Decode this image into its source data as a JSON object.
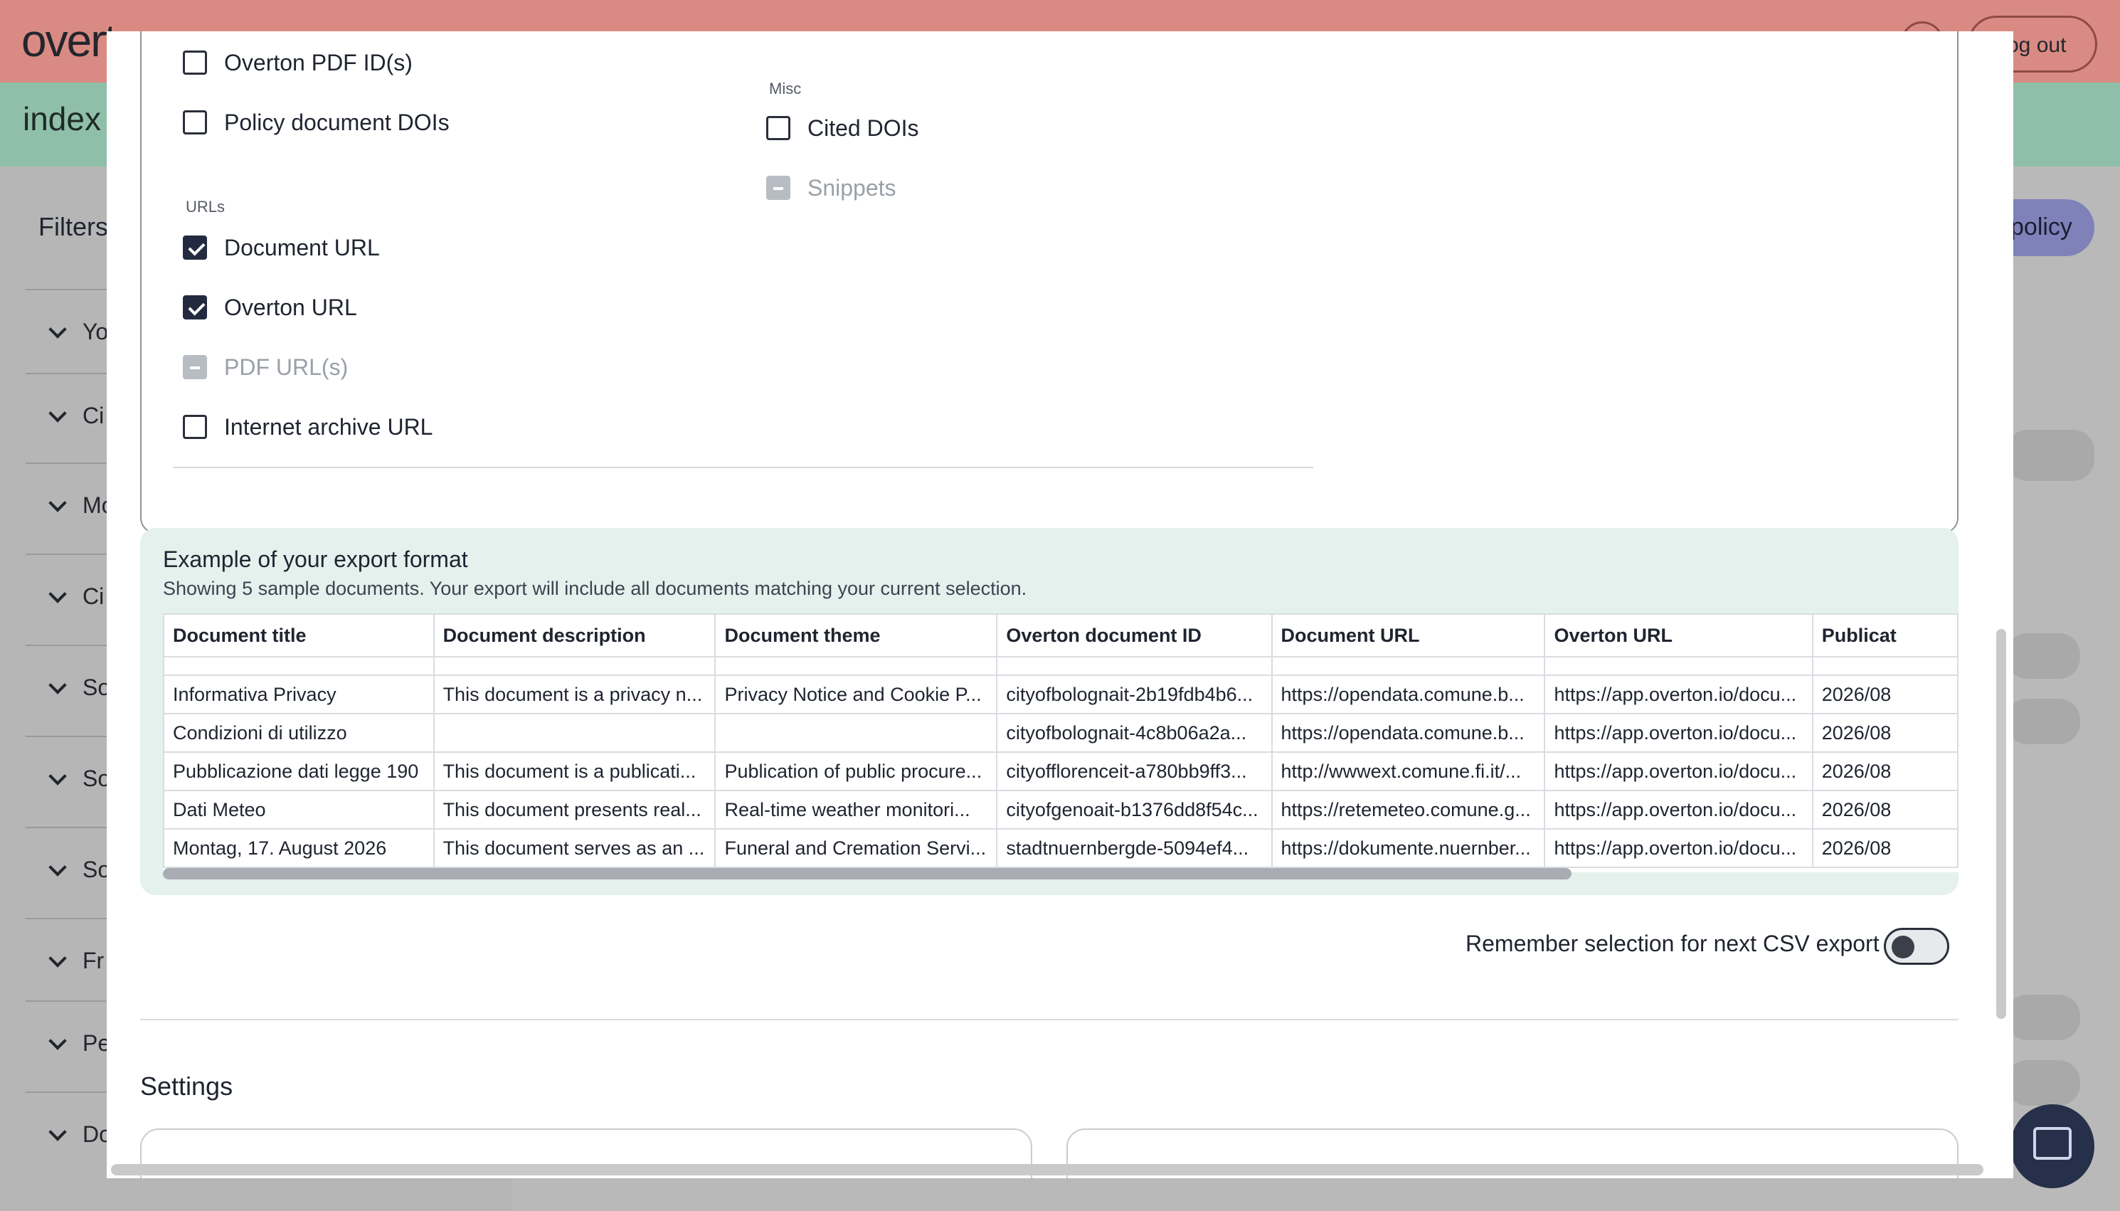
{
  "background": {
    "logo": "overt",
    "logout": "og out",
    "index": "index",
    "filters": "Filters",
    "policy_button": "policy",
    "filter_rows": [
      "Yo",
      "Ci",
      "Mo",
      "Ci",
      "So",
      "So",
      "So",
      "Fr",
      "Pe",
      "Do"
    ]
  },
  "modal": {
    "groups": [
      {
        "label": "",
        "items": [
          {
            "label": "Overton PDF ID(s)",
            "state": "unchecked"
          },
          {
            "label": "Policy document DOIs",
            "state": "unchecked"
          }
        ]
      },
      {
        "label": "URLs",
        "items": [
          {
            "label": "Document URL",
            "state": "checked"
          },
          {
            "label": "Overton URL",
            "state": "checked"
          },
          {
            "label": "PDF URL(s)",
            "state": "indeterminate"
          },
          {
            "label": "Internet archive URL",
            "state": "unchecked"
          }
        ]
      },
      {
        "label": "Misc",
        "items": [
          {
            "label": "Cited DOIs",
            "state": "unchecked"
          },
          {
            "label": "Snippets",
            "state": "indeterminate"
          }
        ]
      }
    ],
    "example": {
      "title": "Example of your export format",
      "subtitle": "Showing 5 sample documents. Your export will include all documents matching your current selection.",
      "columns": [
        "Document title",
        "Document description",
        "Document theme",
        "Overton document ID",
        "Document URL",
        "Overton URL",
        "Publicat"
      ],
      "rows": [
        [
          "Informativa Privacy",
          "This document is a privacy n...",
          "Privacy Notice and Cookie P...",
          "cityofbolognait-2b19fdb4b6...",
          "https://opendata.comune.b...",
          "https://app.overton.io/docu...",
          "2026/08"
        ],
        [
          "Condizioni di utilizzo",
          "",
          "",
          "cityofbolognait-4c8b06a2a...",
          "https://opendata.comune.b...",
          "https://app.overton.io/docu...",
          "2026/08"
        ],
        [
          "Pubblicazione dati legge 190",
          "This document is a publicati...",
          "Publication of public procure...",
          "cityofflorenceit-a780bb9ff3...",
          "http://wwwext.comune.fi.it/...",
          "https://app.overton.io/docu...",
          "2026/08"
        ],
        [
          "Dati Meteo",
          "This document presents real...",
          "Real-time weather monitori...",
          "cityofgenoait-b1376dd8f54c...",
          "https://retemeteo.comune.g...",
          "https://app.overton.io/docu...",
          "2026/08"
        ],
        [
          "Montag, 17. August 2026",
          "This document serves as an ...",
          "Funeral and Cremation Servi...",
          "stadtnuernbergde-5094ef4...",
          "https://dokumente.nuernber...",
          "https://app.overton.io/docu...",
          "2026/08"
        ]
      ]
    },
    "remember": {
      "label": "Remember selection for next CSV export",
      "enabled": false
    },
    "settings": {
      "title": "Settings"
    }
  }
}
